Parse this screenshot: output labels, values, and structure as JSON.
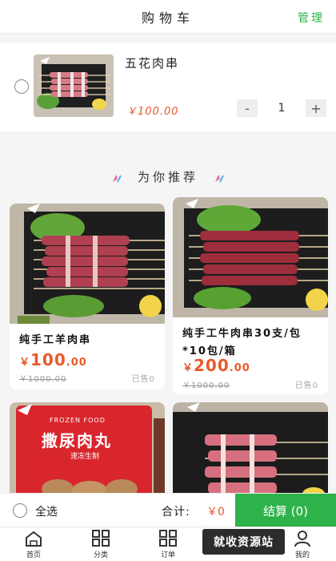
{
  "header": {
    "title": "购物车",
    "manage": "管理"
  },
  "cart": {
    "item": {
      "name": "五花肉串",
      "price": "￥100.00",
      "quantity": "1",
      "minus": "-",
      "plus": "+"
    }
  },
  "recommend": {
    "title": "为你推荐",
    "products": [
      {
        "name": "纯手工羊肉串",
        "currency": "￥",
        "price_int": "100",
        "price_dec": ".00",
        "original": "￥1000.00",
        "sold": "已售0"
      },
      {
        "name": "纯手工牛肉串30支/包*10包/箱",
        "currency": "￥",
        "price_int": "200",
        "price_dec": ".00",
        "original": "￥1000.00",
        "sold": "已售0"
      },
      {
        "label_top": "FROZEN FOOD",
        "label_big": "撒尿肉丸",
        "label_small": "速冻生制"
      }
    ]
  },
  "checkout": {
    "select_all": "全选",
    "total_label": "合计:",
    "total_value": "￥0",
    "pay_button": "结算 (0)"
  },
  "tabs": [
    {
      "label": "首页",
      "icon": "home-icon"
    },
    {
      "label": "分类",
      "icon": "grid-icon"
    },
    {
      "label": "订单",
      "icon": "grid-icon"
    },
    {
      "label": "我的",
      "icon": "user-icon"
    }
  ],
  "overlay": {
    "text": "就收资源站"
  },
  "colors": {
    "accent": "#2eb24a",
    "price": "#e85a2a"
  }
}
